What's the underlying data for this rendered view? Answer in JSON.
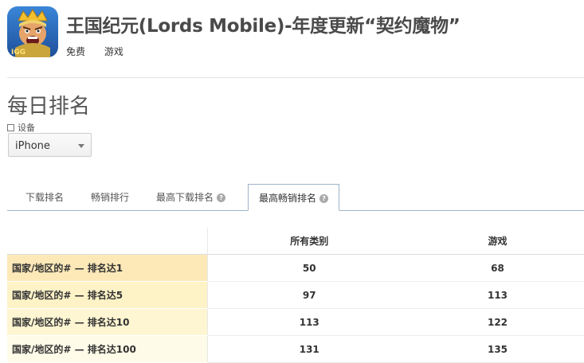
{
  "app": {
    "title": "王国纪元(Lords Mobile)-年度更新“契约魔物”",
    "price": "免费",
    "category": "游戏",
    "icon": "game-hero-icon"
  },
  "section": {
    "title": "每日排名"
  },
  "device": {
    "label": "设备",
    "selected": "iPhone"
  },
  "tabs": [
    {
      "label": "下载排名",
      "active": false,
      "help": false
    },
    {
      "label": "畅销排行",
      "active": false,
      "help": false
    },
    {
      "label": "最高下载排名",
      "active": false,
      "help": true
    },
    {
      "label": "最高畅销排名",
      "active": true,
      "help": true
    }
  ],
  "table": {
    "columns": [
      "所有类别",
      "游戏"
    ],
    "rows": [
      {
        "label": "国家/地区的# — 排名达1",
        "values": [
          "50",
          "68"
        ],
        "color": "#fde9b8"
      },
      {
        "label": "国家/地区的# — 排名达5",
        "values": [
          "97",
          "113"
        ],
        "color": "#fef3c7"
      },
      {
        "label": "国家/地区的# — 排名达10",
        "values": [
          "113",
          "122"
        ],
        "color": "#fef6d2"
      },
      {
        "label": "国家/地区的# — 排名达100",
        "values": [
          "131",
          "135"
        ],
        "color": "#fefbe8"
      }
    ]
  }
}
